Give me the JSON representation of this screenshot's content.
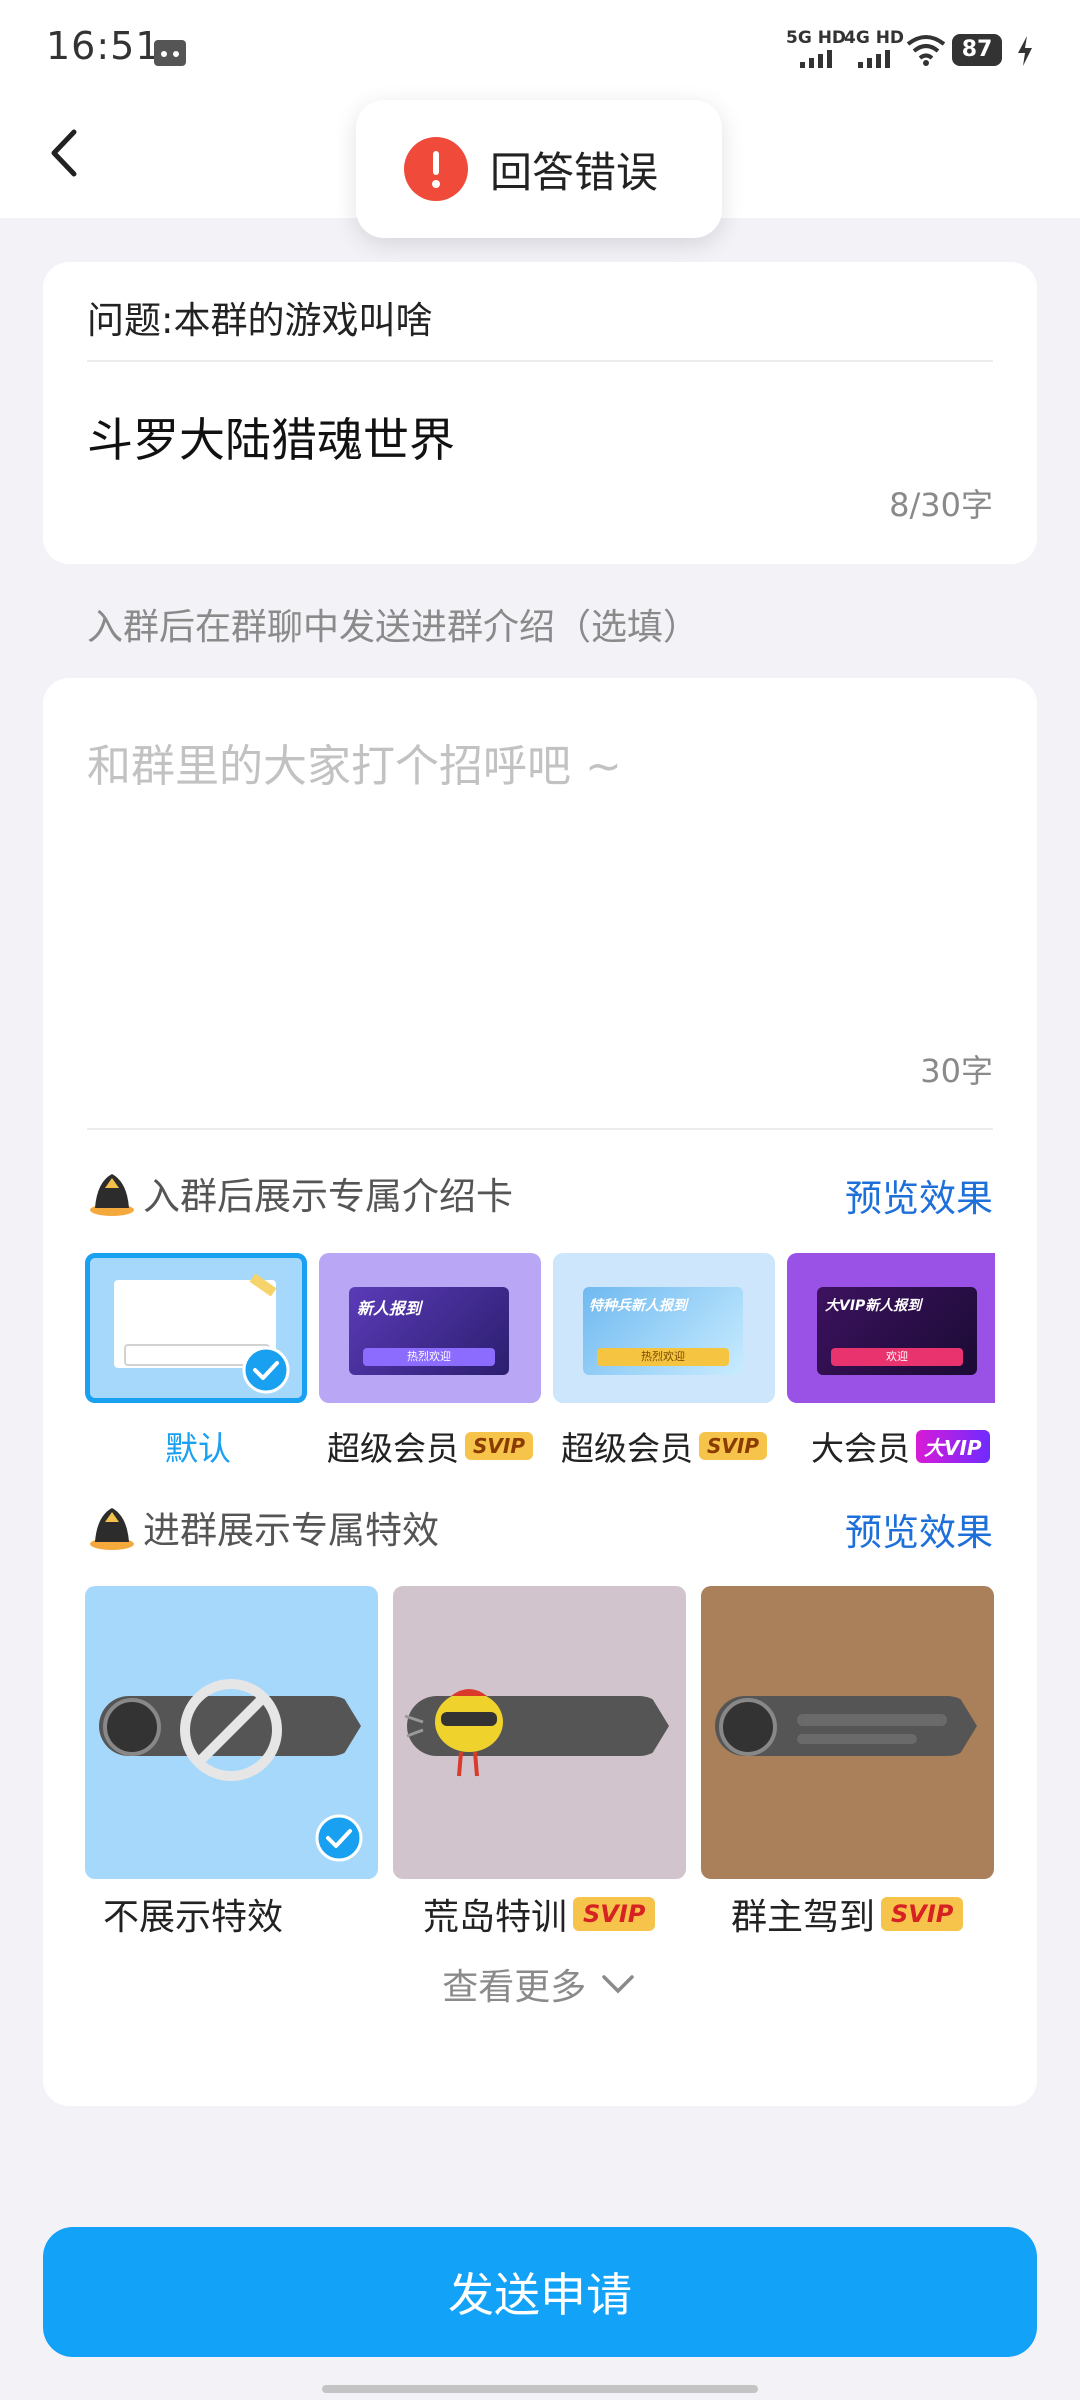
{
  "status": {
    "time": "16:51",
    "battery": "87",
    "net1": "5G HD",
    "net2": "4G HD"
  },
  "toast": {
    "text": "回答错误"
  },
  "question": {
    "label": "问题:本群的游戏叫啥",
    "answer": "斗罗大陆猎魂世界",
    "counter": "8/30字"
  },
  "intro": {
    "hint": "入群后在群聊中发送进群介绍（选填）",
    "placeholder": "和群里的大家打个招呼吧 ~",
    "counter": "30字"
  },
  "card_section": {
    "title": "入群后展示专属介绍卡",
    "preview": "预览效果",
    "options": [
      {
        "label": "默认",
        "badge": ""
      },
      {
        "label": "超级会员",
        "badge": "SVIP",
        "banner": "新人报到",
        "button": "热烈欢迎"
      },
      {
        "label": "超级会员",
        "badge": "SVIP",
        "banner": "特种兵新人报到",
        "button": "热烈欢迎"
      },
      {
        "label": "大会员",
        "badge": "VIP",
        "banner": "大VIP新人报到",
        "button": "欢迎"
      }
    ]
  },
  "effect_section": {
    "title": "进群展示专属特效",
    "preview": "预览效果",
    "options": [
      {
        "label": "不展示特效",
        "badge": ""
      },
      {
        "label": "荒岛特训",
        "badge": "SVIP"
      },
      {
        "label": "群主驾到",
        "badge": "SVIP"
      }
    ],
    "see_more": "查看更多"
  },
  "send_button": "发送申请",
  "colors": {
    "accent": "#12a2f8",
    "link": "#1e6fd9",
    "error": "#f04a3a",
    "svip": "#f6c34b"
  }
}
